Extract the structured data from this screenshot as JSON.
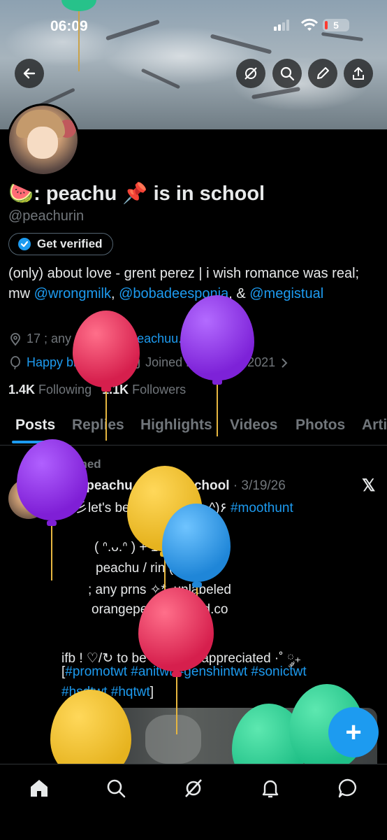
{
  "status": {
    "time": "06:09",
    "battery": "5"
  },
  "profile": {
    "display_name": "🍉: peachu 📌 is in school",
    "handle": "@peachurin",
    "get_verified": "Get verified",
    "bio_text_1": "(only) about love - grent perez | i wish romance was real; mw ",
    "bio_mention_1": "@wrongmilk",
    "bio_sep_1": ", ",
    "bio_mention_2": "@bobadeesponja",
    "bio_sep_2": ", & ",
    "bio_mention_3": "@megistual",
    "location": "17 ; any prns",
    "website": "peachuu.straw.page",
    "birthday": "Happy birthday!",
    "joined": "Joined November 2021",
    "following_count": "1.4K",
    "following_label": "Following",
    "followers_count": "1.1K",
    "followers_label": "Followers"
  },
  "tabs": [
    "Posts",
    "Replies",
    "Highlights",
    "Videos",
    "Photos",
    "Arti"
  ],
  "pinned_tweet": {
    "pinned_label": "Pinned",
    "author": "🍉: peachu 📌 is in school",
    "date": "· 3/19/26",
    "line1": "★彡let's be friends! ٩(^‿^)۶ ",
    "line1_tag": "#moothunt",
    "line2": "( ᐢ.ᴗ.ᐢ )  +  18 ♀♀ filo",
    "line3": "peachu / rin (  ̄▽ ̄)",
    "line4": "; any prns ✧*. unlabeled",
    "line5": "orangepeachu.carrd.co",
    "line6": "ifb ! ♡/↻ to be moots + appreciated ·˚ ༘₊",
    "line7_open": "[",
    "line7_tags": "#promotwt #anitwt #genshintwt #sonictwt",
    "line8_tags": "#hsdtwt #hqtwt",
    "line8_close": "]"
  },
  "fab": "+",
  "colors": {
    "accent": "#1d9bf0",
    "bg": "#000000",
    "muted": "#71767b",
    "text": "#e7e9ea"
  }
}
